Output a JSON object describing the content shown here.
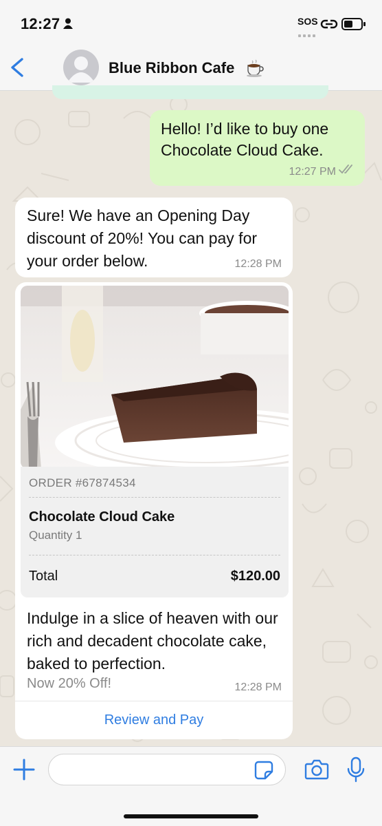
{
  "status_bar": {
    "time": "12:27",
    "sos": "SOS"
  },
  "header": {
    "contact_name": "Blue Ribbon Cafe",
    "contact_emoji": "☕"
  },
  "messages": {
    "outgoing": {
      "text": "Hello! I’d like to buy one Chocolate Cloud Cake.",
      "time": "12:27 PM"
    },
    "incoming": {
      "text": "Sure! We have an Opening Day discount of 20%! You can pay for your order below.",
      "time": "12:28 PM"
    },
    "order_card": {
      "order_number": "ORDER #67874534",
      "item_name": "Chocolate Cloud Cake",
      "quantity": "Quantity 1",
      "total_label": "Total",
      "total_value": "$120.00",
      "description": "Indulge in a slice of heaven with our rich and decadent chocolate cake, baked to perfection.",
      "promo": "Now 20% Off!",
      "time": "12:28 PM",
      "action_label": "Review and Pay"
    }
  },
  "input_bar": {
    "placeholder": ""
  },
  "colors": {
    "outgoing_bubble": "#dcf8c6",
    "incoming_bubble": "#ffffff",
    "link_blue": "#2f7de1",
    "chat_background": "#ebe6de"
  }
}
